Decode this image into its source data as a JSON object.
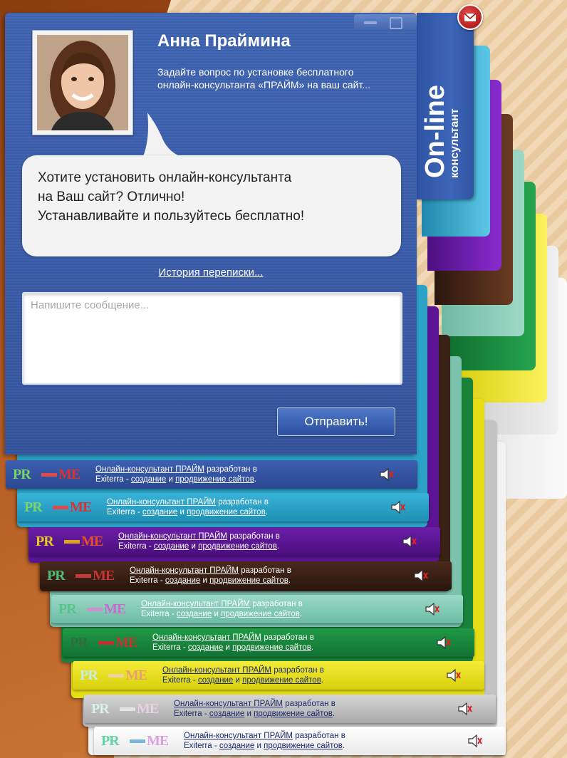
{
  "widget": {
    "operator_name": "Анна Праймина",
    "operator_subtitle": "Задайте вопрос по установке бесплатного онлайн-консультанта «ПРАЙМ» на ваш сайт...",
    "bubble_line1": "Хотите установить онлайн-консультанта",
    "bubble_line2": "на Ваш сайт? Отлично!",
    "bubble_line3": "Устанавливайте и пользуйтесь бесплатно!",
    "history_link": "История переписки...",
    "message_placeholder": "Напишите сообщение...",
    "send_button": "Отправить!",
    "tab_big": "On-line",
    "tab_small": "консультант",
    "icons": {
      "minimize": "minimize-icon",
      "restore": "restore-icon",
      "mail": "mail-icon",
      "sound": "speaker-mute-icon"
    }
  },
  "footer": {
    "logo_pr": "PR",
    "logo_me": "ME",
    "link1": "Онлайн-консультант ПРАЙМ",
    "text1": " разработан в",
    "text2a": "Exiterra - ",
    "link2": "создание",
    "text2b": " и ",
    "link3": "продвижение сайтов",
    "text2c": "."
  },
  "themes": [
    {
      "name": "blue",
      "color": "#3550a0"
    },
    {
      "name": "cyan",
      "color": "#2ba2c6"
    },
    {
      "name": "purple",
      "color": "#5b1594"
    },
    {
      "name": "brown",
      "color": "#3a2116"
    },
    {
      "name": "mint",
      "color": "#7fc6b0"
    },
    {
      "name": "green",
      "color": "#17843a"
    },
    {
      "name": "yellow",
      "color": "#e9e119"
    },
    {
      "name": "gray",
      "color": "#b5b5b5"
    },
    {
      "name": "white",
      "color": "#f4f4f4"
    }
  ]
}
